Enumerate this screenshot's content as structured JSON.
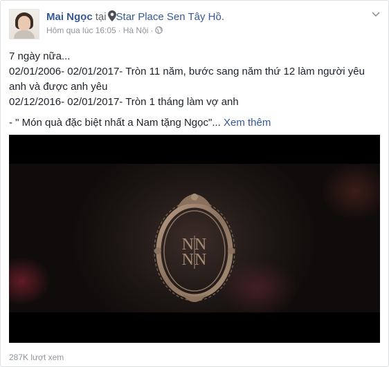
{
  "post": {
    "author": "Mai Ngọc",
    "at_word": "tại",
    "place": "Star Place Sen Tây Hồ.",
    "timestamp": "Hôm qua lúc 16:05",
    "separator": "·",
    "location": "Hà Nội",
    "privacy_icon": "globe-icon",
    "menu_icon": "chevron-down-icon",
    "lines": [
      "7 ngày nữa...",
      "02/01/2006- 02/01/2017- Tròn 11 năm, bước sang năm thứ 12 làm người yêu anh và được anh yêu",
      "02/12/2016- 02/01/2017- Tròn 1 tháng làm vợ anh"
    ],
    "quote_line": "- \" Món quà đặc biệt nhất a Nam tặng Ngọc\"...",
    "see_more": "Xem thêm"
  },
  "video": {
    "monogram_top": "NN",
    "monogram_bottom": "NN"
  },
  "footer": {
    "views": "287K lượt xem"
  }
}
